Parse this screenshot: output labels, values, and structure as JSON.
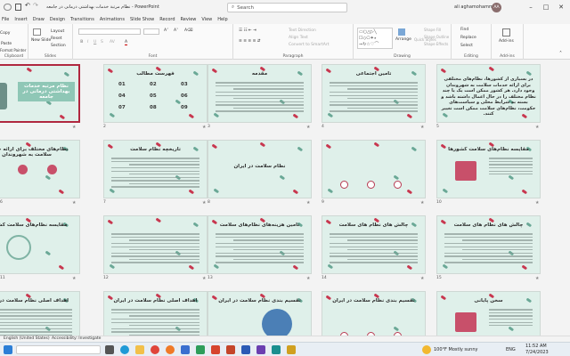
{
  "window": {
    "title": "نظام مرتبة خدمات بهداشتی درمانی در جامعه  -  PowerPoint",
    "search_placeholder": "Search",
    "user": "ali aghamohammadi",
    "user_initials": "AA"
  },
  "tabs": [
    "File",
    "Insert",
    "Draw",
    "Design",
    "Transitions",
    "Animations",
    "Slide Show",
    "Record",
    "Review",
    "View",
    "Help"
  ],
  "ribbon": {
    "clipboard": {
      "label": "Clipboard",
      "paste": "Paste",
      "cut": "Cut",
      "copy": "Copy",
      "format_painter": "Format Painter"
    },
    "slides": {
      "label": "Slides",
      "new_slide": "New Slide",
      "reuse": "Reuse Slides",
      "layout": "Layout",
      "reset": "Reset",
      "section": "Section"
    },
    "font": {
      "label": "Font"
    },
    "paragraph": {
      "label": "Paragraph",
      "text_direction": "Text Direction",
      "align_text": "Align Text",
      "smartart": "Convert to SmartArt"
    },
    "drawing": {
      "label": "Drawing",
      "arrange": "Arrange",
      "quick_styles": "Quick Styles",
      "shape_fill": "Shape Fill",
      "shape_outline": "Shape Outline",
      "shape_effects": "Shape Effects"
    },
    "editing": {
      "label": "Editing",
      "find": "Find",
      "replace": "Replace",
      "select": "Select"
    },
    "addins": {
      "label": "Add-ins",
      "addins": "Add-ins"
    }
  },
  "slides": [
    {
      "num": "",
      "title": "نظام مرتبه خدمات بهداشتی درمانی در جامعه",
      "kind": "cover"
    },
    {
      "num": "2",
      "title": "فهرست مطالب",
      "kind": "toc",
      "items": [
        "01",
        "02",
        "03",
        "04",
        "05",
        "06",
        "07",
        "08",
        "09"
      ]
    },
    {
      "num": "3",
      "title": "مقدمه",
      "kind": "text"
    },
    {
      "num": "4",
      "title": "تامین اجتماعی",
      "kind": "text"
    },
    {
      "num": "5",
      "title": "در بسیاری از کشورها، نظام‌های مختلفی برای ارائه خدمات سلامت به شهروندان وجود دارد. هر کشور ممکن است یک یا چند نظام مختلف را در حال اعمال داشته باشد و بسته به شرایط محلی و سیاست‌های حکومت، نظام‌های سلامت ممکن است تغییر کنند.",
      "kind": "bigtext"
    },
    {
      "num": "6",
      "title": "نظام‌های مختلف برای ارائه خدمات سلامت به شهروندان",
      "kind": "circles"
    },
    {
      "num": "7",
      "title": "تاریخچه نظام سلامت",
      "kind": "text"
    },
    {
      "num": "8",
      "title": "نظام سلامت در ایران",
      "kind": "titleonly"
    },
    {
      "num": "9",
      "title": "",
      "kind": "diagram"
    },
    {
      "num": "10",
      "title": "مقایسه نظام‌های سلامت کشورها",
      "kind": "kit"
    },
    {
      "num": "11",
      "title": "مقایسه نظام‌های سلامت کشورها",
      "kind": "stetho"
    },
    {
      "num": "12",
      "title": "",
      "kind": "text2"
    },
    {
      "num": "13",
      "title": "تامین هزینه‌های نظام‌های سلامت",
      "kind": "text"
    },
    {
      "num": "14",
      "title": "چالش های نظام های سلامت",
      "kind": "text"
    },
    {
      "num": "15",
      "title": "چالش های نظام های سلامت",
      "kind": "text"
    },
    {
      "num": "",
      "title": "اهداف اصلی نظام سلامت در ایران",
      "kind": "text"
    },
    {
      "num": "",
      "title": "اهداف اصلی نظام سلامت در ایران",
      "kind": "text"
    },
    {
      "num": "",
      "title": "تقسیم بندی نظام سلامت در ایران",
      "kind": "doctor"
    },
    {
      "num": "",
      "title": "تقسیم بندی نظام سلامت در ایران",
      "kind": "diagram"
    },
    {
      "num": "",
      "title": "سخن پایانی",
      "kind": "clipboard"
    }
  ],
  "status": {
    "language": "English (United States)",
    "accessibility": "Accessibility: Investigate"
  },
  "taskbar": {
    "weather": "100°F  Mostly sunny",
    "lang": "ENG",
    "time": "11:52 AM",
    "date": "7/24/2023"
  },
  "colors": {
    "accent": "#b7472a",
    "slide_bg": "#dff0ea",
    "pill_red": "#c8374f",
    "pill_green": "#6aa896",
    "selected": "#b0273f"
  }
}
